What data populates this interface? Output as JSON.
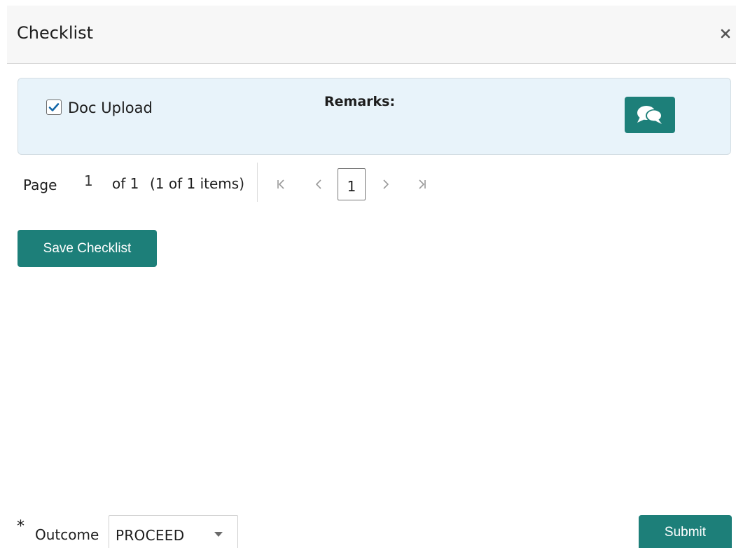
{
  "dialog": {
    "title": "Checklist",
    "close_icon": "close-icon"
  },
  "checklist": {
    "items": [
      {
        "label": "Doc Upload",
        "checked": true,
        "remarks_label": "Remarks:",
        "remarks_icon": "comments-icon"
      }
    ]
  },
  "pagination": {
    "page_word": "Page",
    "current_page": "1",
    "of_total": "of 1",
    "items_info": "(1 of 1 items)",
    "page_button": "1",
    "icons": [
      "first-page-icon",
      "prev-page-icon",
      "next-page-icon",
      "last-page-icon"
    ]
  },
  "actions": {
    "save_label": "Save Checklist",
    "submit_label": "Submit"
  },
  "outcome": {
    "required_marker": "*",
    "label": "Outcome",
    "selected": "PROCEED"
  },
  "colors": {
    "accent": "#1d7f79",
    "card_background": "#e8f3fa",
    "checkbox_check": "#1467a8"
  }
}
